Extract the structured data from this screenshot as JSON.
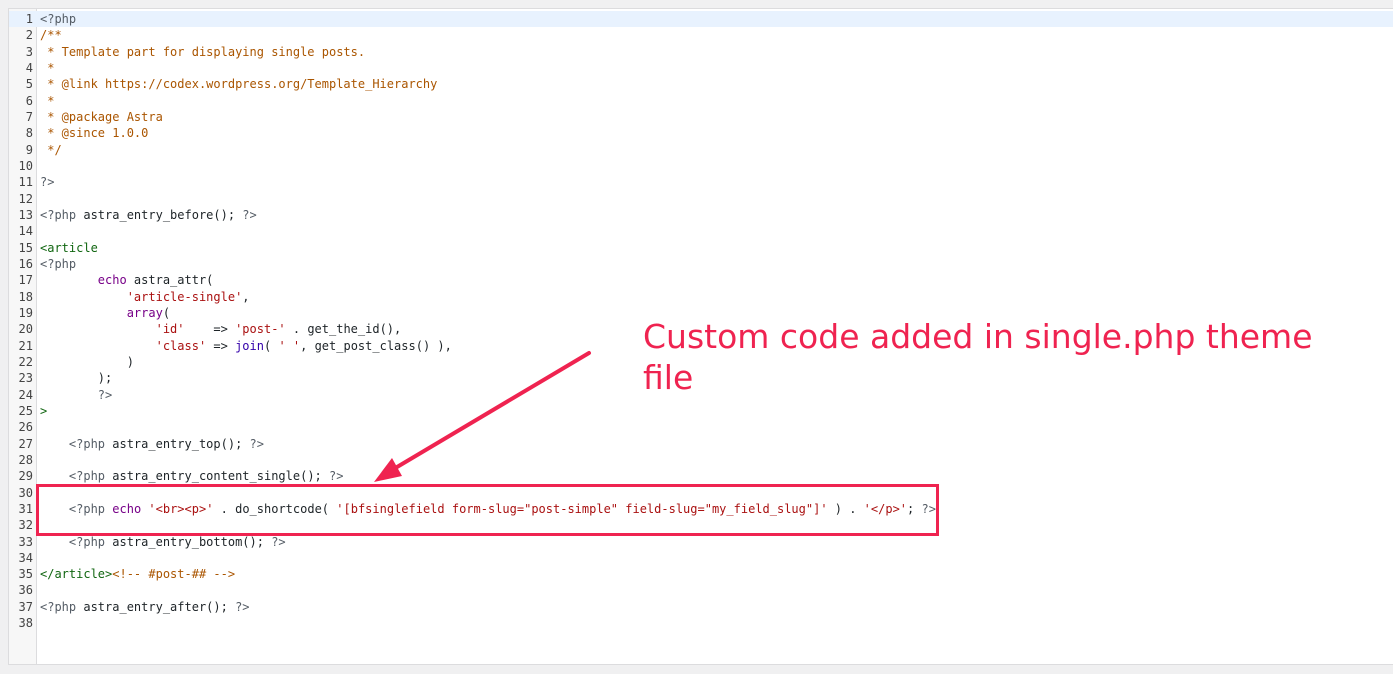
{
  "editor": {
    "lines": [
      {
        "n": "1",
        "tokens": [
          {
            "c": "t-meta",
            "t": "<?php"
          }
        ]
      },
      {
        "n": "2",
        "tokens": [
          {
            "c": "t-comment",
            "t": "/**"
          }
        ]
      },
      {
        "n": "3",
        "tokens": [
          {
            "c": "t-comment",
            "t": " * Template part for displaying single posts."
          }
        ]
      },
      {
        "n": "4",
        "tokens": [
          {
            "c": "t-comment",
            "t": " *"
          }
        ]
      },
      {
        "n": "5",
        "tokens": [
          {
            "c": "t-comment",
            "t": " * @link https://codex.wordpress.org/Template_Hierarchy"
          }
        ]
      },
      {
        "n": "6",
        "tokens": [
          {
            "c": "t-comment",
            "t": " *"
          }
        ]
      },
      {
        "n": "7",
        "tokens": [
          {
            "c": "t-comment",
            "t": " * @package Astra"
          }
        ]
      },
      {
        "n": "8",
        "tokens": [
          {
            "c": "t-comment",
            "t": " * @since 1.0.0"
          }
        ]
      },
      {
        "n": "9",
        "tokens": [
          {
            "c": "t-comment",
            "t": " */"
          }
        ]
      },
      {
        "n": "10",
        "tokens": []
      },
      {
        "n": "11",
        "tokens": [
          {
            "c": "t-meta",
            "t": "?>"
          }
        ]
      },
      {
        "n": "12",
        "tokens": []
      },
      {
        "n": "13",
        "tokens": [
          {
            "c": "t-meta",
            "t": "<?php"
          },
          {
            "c": "t-plain",
            "t": " astra_entry_before(); "
          },
          {
            "c": "t-meta",
            "t": "?>"
          }
        ]
      },
      {
        "n": "14",
        "tokens": []
      },
      {
        "n": "15",
        "tokens": [
          {
            "c": "t-tag",
            "t": "<article"
          }
        ]
      },
      {
        "n": "16",
        "tokens": [
          {
            "c": "t-meta",
            "t": "<?php"
          }
        ]
      },
      {
        "n": "17",
        "tokens": [
          {
            "c": "t-plain",
            "t": "        "
          },
          {
            "c": "t-keyword",
            "t": "echo"
          },
          {
            "c": "t-plain",
            "t": " astra_attr("
          }
        ]
      },
      {
        "n": "18",
        "tokens": [
          {
            "c": "t-plain",
            "t": "            "
          },
          {
            "c": "t-string",
            "t": "'article-single'"
          },
          {
            "c": "t-plain",
            "t": ","
          }
        ]
      },
      {
        "n": "19",
        "tokens": [
          {
            "c": "t-plain",
            "t": "            "
          },
          {
            "c": "t-keyword",
            "t": "array"
          },
          {
            "c": "t-plain",
            "t": "("
          }
        ]
      },
      {
        "n": "20",
        "tokens": [
          {
            "c": "t-plain",
            "t": "                "
          },
          {
            "c": "t-string",
            "t": "'id'"
          },
          {
            "c": "t-plain",
            "t": "    => "
          },
          {
            "c": "t-string",
            "t": "'post-'"
          },
          {
            "c": "t-plain",
            "t": " . get_the_id(),"
          }
        ]
      },
      {
        "n": "21",
        "tokens": [
          {
            "c": "t-plain",
            "t": "                "
          },
          {
            "c": "t-string",
            "t": "'class'"
          },
          {
            "c": "t-plain",
            "t": " => "
          },
          {
            "c": "t-builtin",
            "t": "join"
          },
          {
            "c": "t-plain",
            "t": "( "
          },
          {
            "c": "t-string",
            "t": "' '"
          },
          {
            "c": "t-plain",
            "t": ", get_post_class() ),"
          }
        ]
      },
      {
        "n": "22",
        "tokens": [
          {
            "c": "t-plain",
            "t": "            )"
          }
        ]
      },
      {
        "n": "23",
        "tokens": [
          {
            "c": "t-plain",
            "t": "        );"
          }
        ]
      },
      {
        "n": "24",
        "tokens": [
          {
            "c": "t-plain",
            "t": "        "
          },
          {
            "c": "t-meta",
            "t": "?>"
          }
        ]
      },
      {
        "n": "25",
        "tokens": [
          {
            "c": "t-tag",
            "t": ">"
          }
        ]
      },
      {
        "n": "26",
        "tokens": []
      },
      {
        "n": "27",
        "tokens": [
          {
            "c": "t-plain",
            "t": "    "
          },
          {
            "c": "t-meta",
            "t": "<?php"
          },
          {
            "c": "t-plain",
            "t": " astra_entry_top(); "
          },
          {
            "c": "t-meta",
            "t": "?>"
          }
        ]
      },
      {
        "n": "28",
        "tokens": []
      },
      {
        "n": "29",
        "tokens": [
          {
            "c": "t-plain",
            "t": "    "
          },
          {
            "c": "t-meta",
            "t": "<?php"
          },
          {
            "c": "t-plain",
            "t": " astra_entry_content_single(); "
          },
          {
            "c": "t-meta",
            "t": "?>"
          }
        ]
      },
      {
        "n": "30",
        "tokens": []
      },
      {
        "n": "31",
        "tokens": [
          {
            "c": "t-plain",
            "t": "    "
          },
          {
            "c": "t-meta",
            "t": "<?php"
          },
          {
            "c": "t-plain",
            "t": " "
          },
          {
            "c": "t-keyword",
            "t": "echo"
          },
          {
            "c": "t-plain",
            "t": " "
          },
          {
            "c": "t-string",
            "t": "'<br><p>'"
          },
          {
            "c": "t-plain",
            "t": " . do_shortcode( "
          },
          {
            "c": "t-string",
            "t": "'[bfsinglefield form-slug=\"post-simple\" field-slug=\"my_field_slug\"]'"
          },
          {
            "c": "t-plain",
            "t": " ) . "
          },
          {
            "c": "t-string",
            "t": "'</p>'"
          },
          {
            "c": "t-plain",
            "t": "; "
          },
          {
            "c": "t-meta",
            "t": "?>"
          }
        ]
      },
      {
        "n": "32",
        "tokens": []
      },
      {
        "n": "33",
        "tokens": [
          {
            "c": "t-plain",
            "t": "    "
          },
          {
            "c": "t-meta",
            "t": "<?php"
          },
          {
            "c": "t-plain",
            "t": " astra_entry_bottom(); "
          },
          {
            "c": "t-meta",
            "t": "?>"
          }
        ]
      },
      {
        "n": "34",
        "tokens": []
      },
      {
        "n": "35",
        "tokens": [
          {
            "c": "t-tag",
            "t": "</article>"
          },
          {
            "c": "t-comment",
            "t": "<!-- #post-## -->"
          }
        ]
      },
      {
        "n": "36",
        "tokens": []
      },
      {
        "n": "37",
        "tokens": [
          {
            "c": "t-meta",
            "t": "<?php"
          },
          {
            "c": "t-plain",
            "t": " astra_entry_after(); "
          },
          {
            "c": "t-meta",
            "t": "?>"
          }
        ]
      },
      {
        "n": "38",
        "tokens": []
      }
    ]
  },
  "annotation": {
    "text": "Custom code added in single.php theme file",
    "color": "#ef2350"
  }
}
